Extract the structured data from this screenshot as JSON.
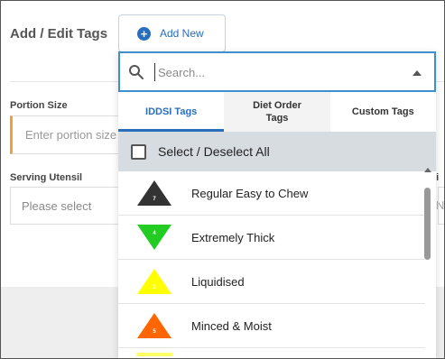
{
  "page": {
    "title": "Add / Edit Tags",
    "add_new_label": "Add New",
    "portion_label": "Portion Size",
    "portion_placeholder": "Enter portion size",
    "utensil_label": "Serving Utensil",
    "utensil_placeholder": "Please select",
    "right_ghost_1": "si",
    "right_ghost_2": "N"
  },
  "dropdown": {
    "search_placeholder": "Search...",
    "tabs": [
      {
        "label": "IDDSI Tags",
        "active": true
      },
      {
        "label": "Diet Order\nTags",
        "active": false
      },
      {
        "label": "Custom Tags",
        "active": false
      }
    ],
    "select_all_label": "Select / Deselect All",
    "items": [
      {
        "label": "Regular Easy to Chew",
        "level": "7",
        "color": "#333333",
        "direction": "up",
        "text_color": "#ffffff"
      },
      {
        "label": "Extremely Thick",
        "level": "4",
        "color": "#22cc22",
        "direction": "down",
        "text_color": "#ffffff"
      },
      {
        "label": "Liquidised",
        "level": "3",
        "color": "#ffff00",
        "direction": "up",
        "text_color": "#ffffff"
      },
      {
        "label": "Minced & Moist",
        "level": "5",
        "color": "#ff6600",
        "direction": "up",
        "text_color": "#ffffff"
      }
    ]
  },
  "colors": {
    "accent": "#2a6ebb",
    "search_border": "#3f8fcf",
    "select_all_bg": "#d7dce1",
    "required_marker": "#e8a33b"
  }
}
